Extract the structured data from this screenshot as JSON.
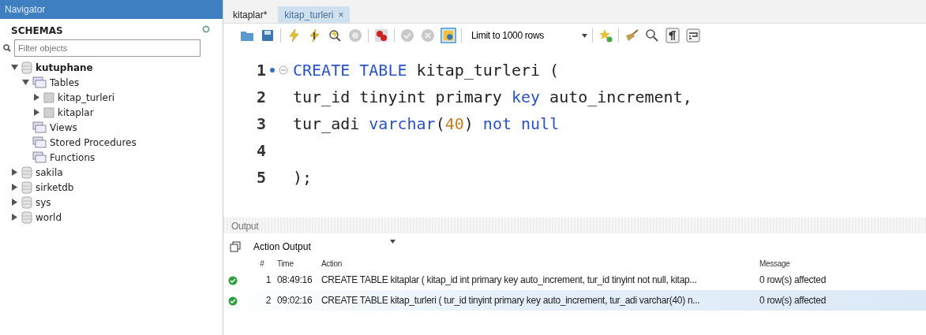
{
  "navigator": {
    "title": "Navigator",
    "section": "SCHEMAS",
    "filter": {
      "placeholder": "Filter objects"
    },
    "tree": [
      {
        "label": "kutuphane",
        "kind": "schema",
        "expanded": true,
        "active": true,
        "children": [
          {
            "label": "Tables",
            "kind": "folder",
            "expanded": true,
            "children": [
              {
                "label": "kitap_turleri",
                "kind": "table",
                "expanded": false
              },
              {
                "label": "kitaplar",
                "kind": "table",
                "expanded": false
              }
            ]
          },
          {
            "label": "Views",
            "kind": "folder"
          },
          {
            "label": "Stored Procedures",
            "kind": "folder"
          },
          {
            "label": "Functions",
            "kind": "folder"
          }
        ]
      },
      {
        "label": "sakila",
        "kind": "schema",
        "expanded": false,
        "active": false
      },
      {
        "label": "sirketdb",
        "kind": "schema",
        "expanded": false,
        "active": false
      },
      {
        "label": "sys",
        "kind": "schema",
        "expanded": false,
        "active": false
      },
      {
        "label": "world",
        "kind": "schema",
        "expanded": false,
        "active": false
      }
    ]
  },
  "tabs": [
    {
      "label": "kitaplar*",
      "selected": false
    },
    {
      "label": "kitap_turleri",
      "selected": true,
      "close": "×"
    }
  ],
  "toolbar": {
    "limit": "Limit to 1000 rows",
    "autocommit": true
  },
  "editor": {
    "lines": [
      {
        "number": "1",
        "marker": true,
        "fold": true,
        "tokens": [
          {
            "kind": "keyword",
            "text": "CREATE TABLE"
          },
          {
            "kind": "ident",
            "text": " kitap_turleri ("
          }
        ]
      },
      {
        "number": "2",
        "tokens": [
          {
            "kind": "ident",
            "text": "tur_id tinyint primary "
          },
          {
            "kind": "keyword",
            "text": "key"
          },
          {
            "kind": "ident",
            "text": " auto_increment,"
          }
        ]
      },
      {
        "number": "3",
        "tokens": [
          {
            "kind": "ident",
            "text": "tur_adi "
          },
          {
            "kind": "keyword",
            "text": "varchar"
          },
          {
            "kind": "ident",
            "text": "("
          },
          {
            "kind": "number",
            "text": "40"
          },
          {
            "kind": "ident",
            "text": ") "
          },
          {
            "kind": "keyword",
            "text": "not null"
          }
        ]
      },
      {
        "number": "4"
      },
      {
        "number": "5",
        "tokens": [
          {
            "kind": "ident",
            "text": ");"
          }
        ]
      }
    ]
  },
  "output": {
    "title": "Output",
    "selector": "Action Output",
    "columns": [
      "#",
      "Time",
      "Action",
      "Message"
    ],
    "rows": [
      {
        "ok": true,
        "number": "1",
        "time": "08:49:16",
        "action": "CREATE TABLE kitaplar ( kitap_id int primary key auto_increment, tur_id tinyint not null, kitap...",
        "message": "0 row(s) affected",
        "selected": false
      },
      {
        "ok": true,
        "number": "2",
        "time": "09:02:16",
        "action": "CREATE TABLE kitap_turleri ( tur_id tinyint primary key auto_increment, tur_adi varchar(40) n...",
        "message": "0 row(s) affected",
        "selected": true
      }
    ]
  }
}
